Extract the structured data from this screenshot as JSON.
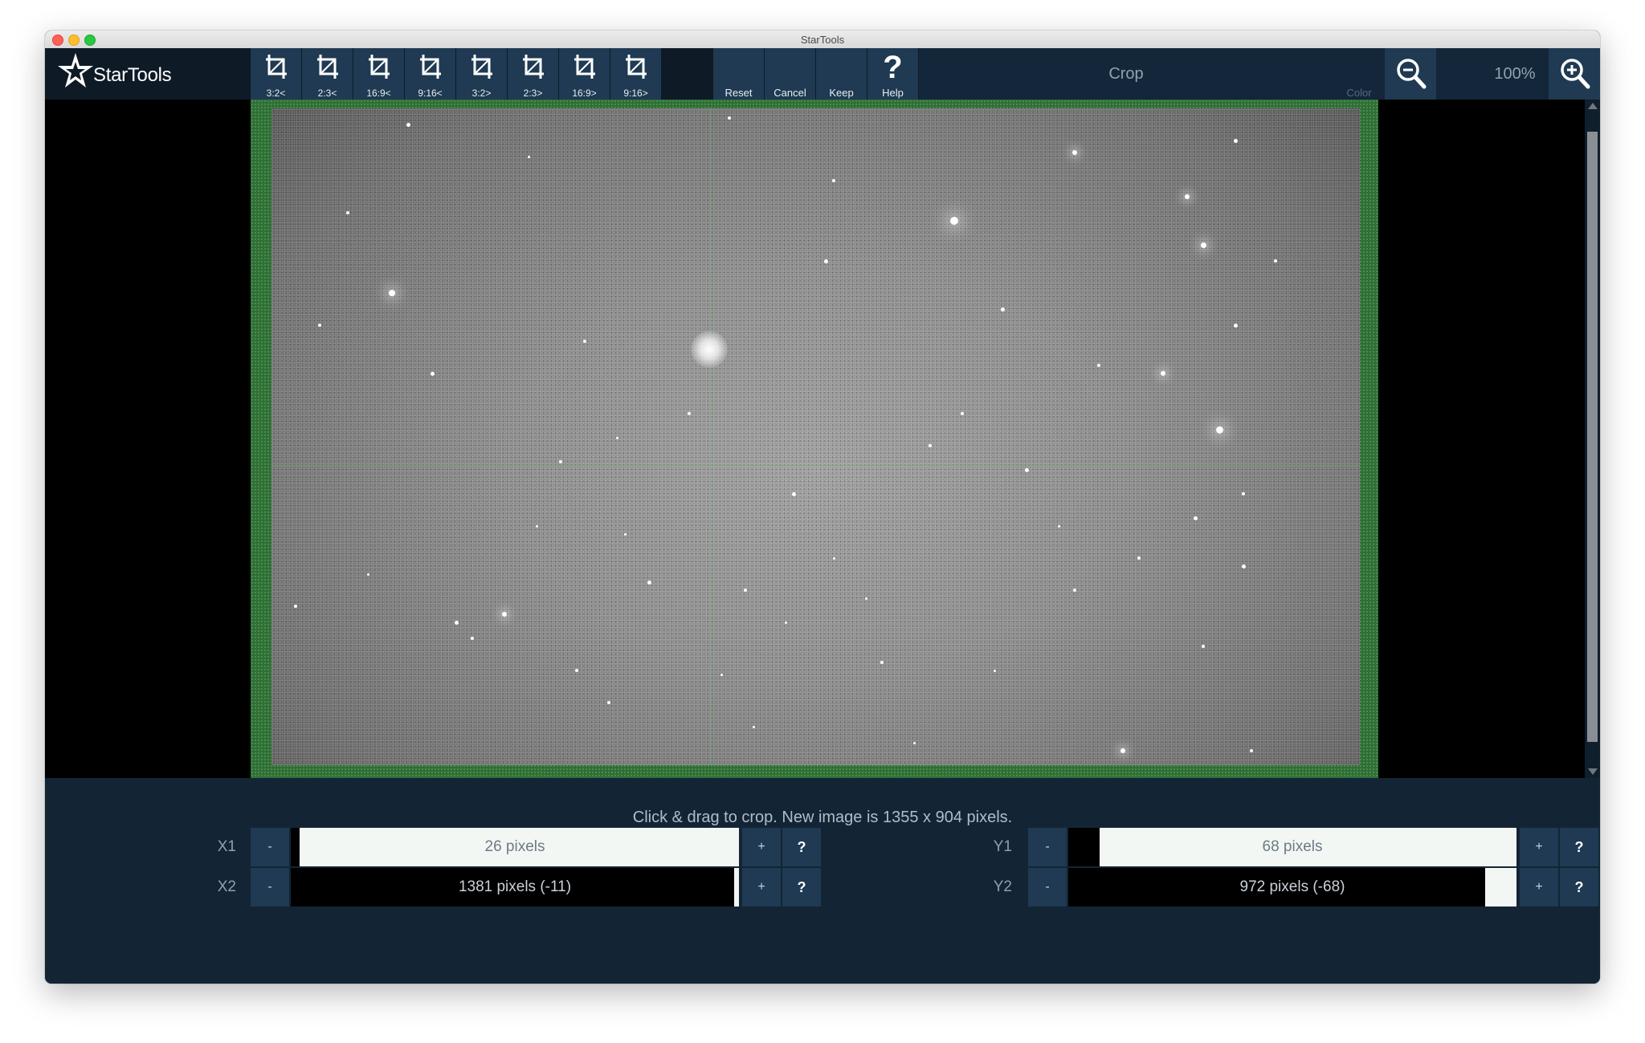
{
  "window": {
    "title": "StarTools"
  },
  "app": {
    "logo_text": "StarTools"
  },
  "toolbar": {
    "crop_presets": [
      "3:2<",
      "2:3<",
      "16:9<",
      "9:16<",
      "3:2>",
      "2:3>",
      "16:9>",
      "9:16>"
    ],
    "reset_label": "Reset",
    "cancel_label": "Cancel",
    "keep_label": "Keep",
    "help_label": "Help",
    "help_glyph": "?",
    "module_title": "Crop",
    "color_label": "Color",
    "zoom_value": "100%",
    "zoom_out_icon": "zoom-out-icon",
    "zoom_in_icon": "zoom-in-icon"
  },
  "status": {
    "message": "Click & drag to crop. New image is 1355 x 904 pixels."
  },
  "params": {
    "x1": {
      "label": "X1",
      "value": "26 pixels",
      "minus": "-",
      "plus": "+",
      "help": "?",
      "fill": 0.02
    },
    "x2": {
      "label": "X2",
      "value": "1381 pixels (-11)",
      "minus": "-",
      "plus": "+",
      "help": "?",
      "fill": 0.99
    },
    "y1": {
      "label": "Y1",
      "value": "68 pixels",
      "minus": "-",
      "plus": "+",
      "help": "?",
      "fill": 0.07
    },
    "y2": {
      "label": "Y2",
      "value": "972 pixels (-68)",
      "minus": "-",
      "plus": "+",
      "help": "?",
      "fill": 0.93
    }
  },
  "colors": {
    "toolbar_bg": "#0e1b27",
    "button_bg": "#1f3a52",
    "panel_bg": "#132535",
    "crop_border": "#2f6f36"
  }
}
